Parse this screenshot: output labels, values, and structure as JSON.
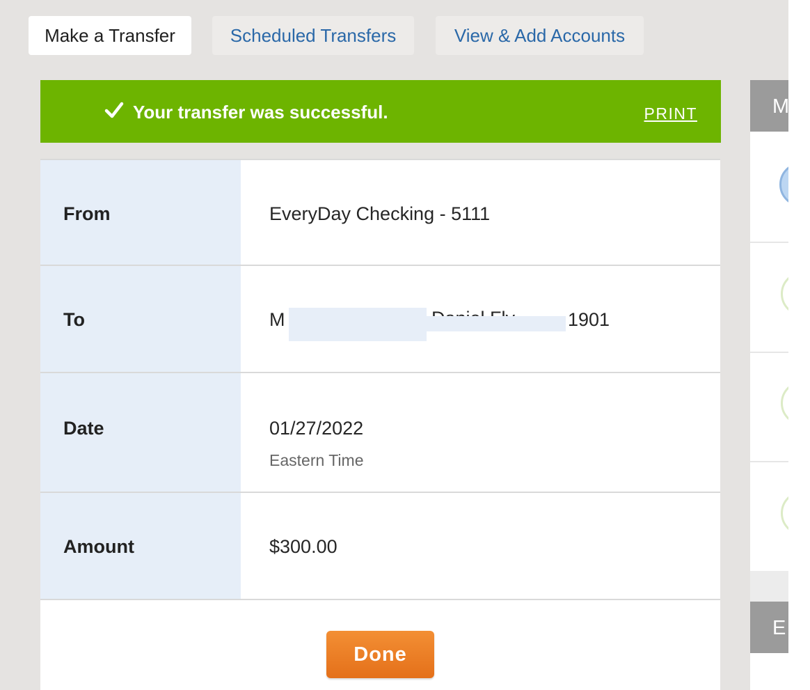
{
  "tabs": [
    {
      "label": "Make a Transfer",
      "active": true
    },
    {
      "label": "Scheduled Transfers",
      "active": false
    },
    {
      "label": "View & Add Accounts",
      "active": false
    }
  ],
  "banner": {
    "message": "Your transfer was successful.",
    "print_label": "PRINT",
    "icon": "checkmark-icon",
    "color": "#6db400"
  },
  "details": {
    "from": {
      "label": "From",
      "value": "EveryDay Checking - 5111"
    },
    "to": {
      "label": "To",
      "value_start": "M",
      "value_end": "1901"
    },
    "date": {
      "label": "Date",
      "value": "01/27/2022",
      "note": "Eastern Time"
    },
    "amount": {
      "label": "Amount",
      "value": "$300.00"
    }
  },
  "done_button": {
    "label": "Done",
    "color": "#ee7d1f"
  },
  "sidebar": {
    "header_top": "M",
    "header_bottom": "E"
  }
}
